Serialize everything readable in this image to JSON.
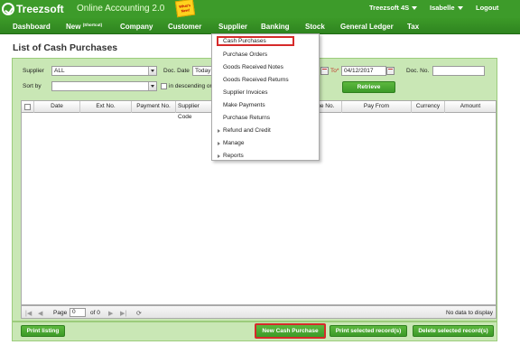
{
  "brand": {
    "logo_text": "Treezsoft",
    "app_name": "Online Accounting 2.0",
    "sticker": "What's New!"
  },
  "user_bar": {
    "company": "Treezsoft 4S",
    "user": "Isabelle",
    "logout": "Logout"
  },
  "nav": {
    "dashboard": "Dashboard",
    "new": "New",
    "new_sup": "(Shortcut)",
    "company": "Company",
    "customer": "Customer",
    "supplier": "Supplier",
    "banking": "Banking",
    "stock": "Stock",
    "general_ledger": "General Ledger",
    "tax": "Tax"
  },
  "page_title": "List of Cash Purchases",
  "filters": {
    "supplier_label": "Supplier",
    "supplier_value": "ALL",
    "doc_date_label": "Doc. Date",
    "doc_date_value": "Today",
    "to_label": "To*",
    "to_value": "04/12/2017",
    "doc_no_label": "Doc. No.",
    "doc_no_value": "",
    "sort_by_label": "Sort by",
    "sort_by_value": "",
    "descending_label": "in descending or",
    "retrieve_button": "Retrieve"
  },
  "table": {
    "columns": [
      "Date",
      "Ext No.",
      "Payment No.",
      "Supplier Code",
      "eque No.",
      "Pay From",
      "Currency",
      "Amount"
    ]
  },
  "pager": {
    "page_label": "Page",
    "page_value": "0",
    "of_label": "of 0",
    "no_data": "No data to display"
  },
  "footer": {
    "print_listing": "Print listing",
    "new_cash_purchase": "New Cash Purchase",
    "print_selected": "Print selected record(s)",
    "delete_selected": "Delete selected record(s)"
  },
  "supplier_menu": {
    "items": [
      "Cash Purchases",
      "Purchase Orders",
      "Goods Received Notes",
      "Goods Received Returns",
      "Supplier Invoices",
      "Make Payments",
      "Purchase Returns",
      "Refund and Credit",
      "Manage",
      "Reports"
    ]
  },
  "colors": {
    "nav_green": "#3c9a28",
    "panel_green": "#c9e7b5",
    "highlight_red": "#d62a2a"
  }
}
